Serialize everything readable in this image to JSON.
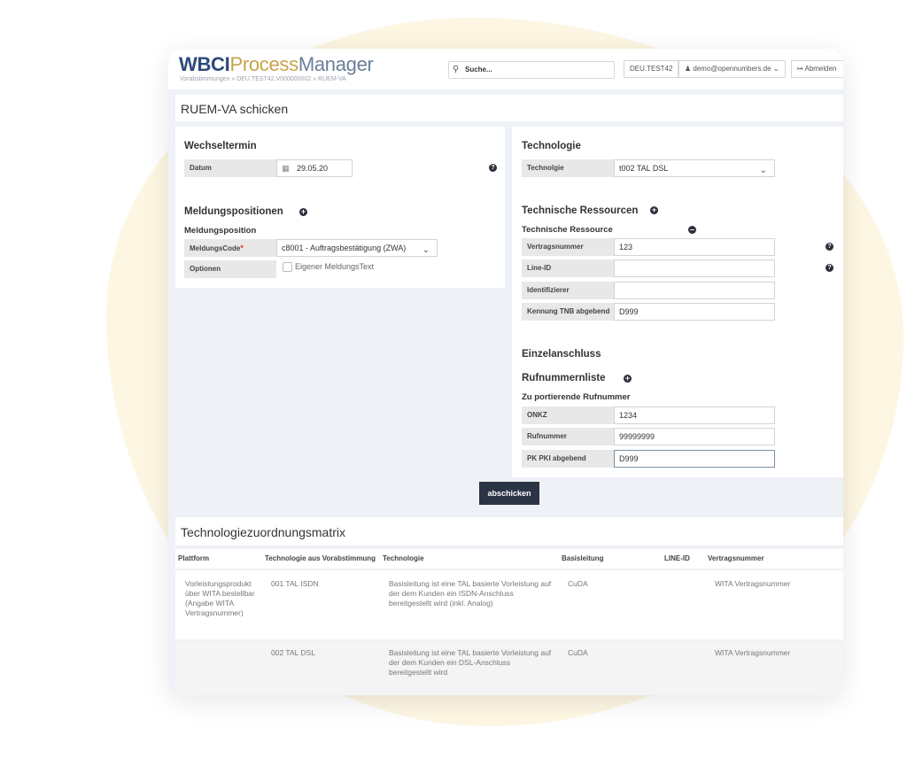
{
  "app": {
    "logo_part1": "WBCI",
    "logo_part2": "Process",
    "logo_part3": "Manager",
    "breadcrumb": "Vorabstimmungen » DEU.TEST42.V000000002 » RUEM-VA",
    "search_placeholder": "Suche...",
    "tenant": "DEU.TEST42",
    "user": "demo@opennumbers.de",
    "logout": "Abmelden"
  },
  "page": {
    "title": "RUEM-VA schicken"
  },
  "wechseltermin": {
    "title": "Wechseltermin",
    "datum_label": "Datum",
    "datum_value": "29.05.20"
  },
  "meldung": {
    "title": "Meldungspositionen",
    "subtitle": "Meldungsposition",
    "code_label": "MeldungsCode",
    "code_value": "c8001 - Auftragsbestätigung (ZWA)",
    "optionen_label": "Optionen",
    "checkbox_label": "Eigener MeldungsText"
  },
  "technologie": {
    "title": "Technologie",
    "label": "Technolgie",
    "value": "t002 TAL DSL"
  },
  "ressourcen": {
    "title": "Technische Ressourcen",
    "subtitle": "Technische Ressource",
    "vertrag_label": "Vertragsnummer",
    "vertrag_value": "123",
    "lineid_label": "Line-ID",
    "lineid_value": "",
    "ident_label": "Identifizierer",
    "ident_value": "",
    "kennung_label": "Kennung TNB abgebend",
    "kennung_value": "D999"
  },
  "einzel": {
    "title": "Einzelanschluss",
    "list_title": "Rufnummernliste",
    "subtitle": "Zu portierende Rufnummer",
    "onkz_label": "ONKZ",
    "onkz_value": "1234",
    "ruf_label": "Rufnummer",
    "ruf_value": "99999999",
    "pk_label": "PK PKI abgebend",
    "pk_value": "D999"
  },
  "submit_label": "abschicken",
  "matrix": {
    "title": "Technologiezuordnungsmatrix",
    "headers": [
      "Plattform",
      "Technologie aus Vorabstimmung",
      "Technologie",
      "Basisleitung",
      "LINE-ID",
      "Vertragsnummer"
    ],
    "rows": [
      {
        "plattform": "Vorleistungsprodukt über WITA bestellbar (Angabe WITA Vertragsnummer)",
        "tech_vorab": "001 TAL ISDN",
        "technologie": "Basisleitung ist eine TAL basierte Vorleistung auf der dem Kunden ein ISDN-Anschluss bereitgestellt wird (inkl. Analog)",
        "basis": "CuDA",
        "lineid": "",
        "vertrag": "WITA Vertragsnummer"
      },
      {
        "plattform": "",
        "tech_vorab": "002 TAL DSL",
        "technologie": "Basisleitung ist eine TAL basierte Vorleistung auf der dem Kunden ein DSL-Anschluss bereitgestellt wird",
        "basis": "CuDA",
        "lineid": "",
        "vertrag": "WITA Vertragsnummer"
      }
    ]
  },
  "icons": {
    "search": "search-icon",
    "user": "user-icon",
    "logout": "logout-icon",
    "calendar": "calendar-icon",
    "help": "help-icon",
    "plus": "plus-circle-icon",
    "minus": "minus-circle-icon",
    "chevron": "chevron-down-icon"
  },
  "colors": {
    "brand_dark": "#2d4a7a",
    "brand_gold": "#c8a34a",
    "button": "#2b3445"
  }
}
